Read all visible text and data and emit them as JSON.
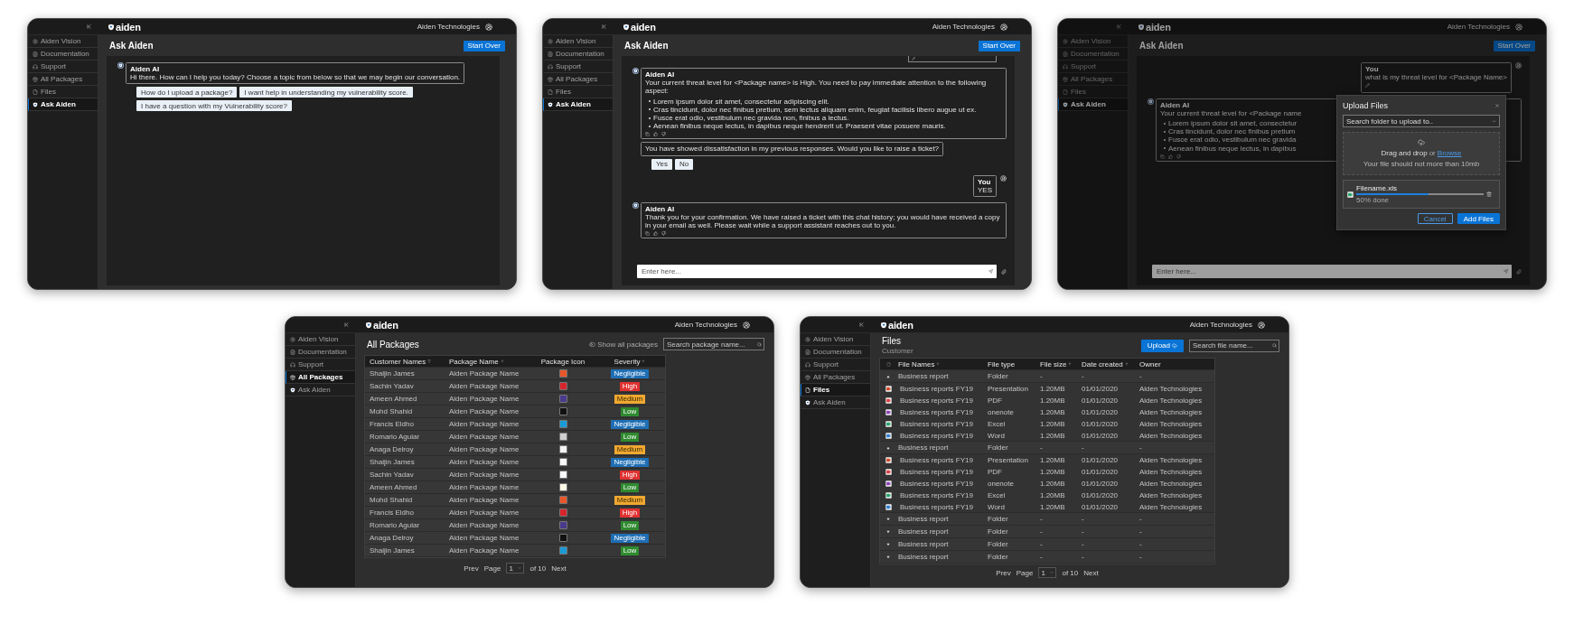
{
  "screens": [
    {
      "kind": "chat",
      "dimmed": false,
      "brand": "aiden",
      "user": "Aiden Technologies",
      "title": "Ask Aiden",
      "start_over": "Start Over",
      "sidebar": [
        {
          "kind": "vision",
          "label": "Aiden Vision",
          "selected": false
        },
        {
          "kind": "docs",
          "label": "Documentation",
          "selected": false
        },
        {
          "kind": "support",
          "label": "Support",
          "selected": false
        },
        {
          "kind": "packages",
          "label": "All Packages",
          "selected": false
        },
        {
          "kind": "files",
          "label": "Files",
          "selected": false
        },
        {
          "kind": "ask",
          "label": "Ask Aiden",
          "selected": true
        }
      ],
      "messages": [
        {
          "kind": "bot",
          "author": "Aiden AI",
          "text": "Hi there. How can I help you today? Choose a topic from below so that we may begin our conversation.",
          "feedback": false
        },
        {
          "kind": "options",
          "options": [
            "How do I upload a package?",
            "I want help in understanding my vulnerability score.",
            "I have a question with my Vulnerability score?"
          ]
        }
      ]
    },
    {
      "kind": "chat",
      "dimmed": false,
      "brand": "aiden",
      "user": "Aiden Technologies",
      "title": "Ask Aiden",
      "start_over": "Start Over",
      "sidebar": [
        {
          "kind": "vision",
          "label": "Aiden Vision",
          "selected": false
        },
        {
          "kind": "docs",
          "label": "Documentation",
          "selected": false
        },
        {
          "kind": "support",
          "label": "Support",
          "selected": false
        },
        {
          "kind": "packages",
          "label": "All Packages",
          "selected": false
        },
        {
          "kind": "files",
          "label": "Files",
          "selected": false
        },
        {
          "kind": "ask",
          "label": "Ask Aiden",
          "selected": true
        }
      ],
      "messages": [
        {
          "kind": "clipped"
        },
        {
          "kind": "bot",
          "author": "Aiden AI",
          "text": "Your current threat level for <Package name> is High. You need to pay immediate attention to the following aspect:",
          "bullets": [
            "Lorem ipsum dolor sit amet, consectetur adipiscing elit.",
            "Cras tincidunt, dolor nec finibus pretium, sem lectus aliquam enim, feugiat facilisis libero augue ut ex.",
            "Fusce erat odio, vestibulum nec gravida non, finibus a lectus.",
            "Aenean finibus neque lectus, in dapibus neque hendrerit ut. Praesent vitae posuere mauris."
          ],
          "feedback": true
        },
        {
          "kind": "notice",
          "text": "You have showed dissatisfaction in my previous responses. Would you like to raise a ticket?"
        },
        {
          "kind": "options",
          "options": [
            "Yes",
            "No"
          ]
        },
        {
          "kind": "user",
          "author": "You",
          "text": "YES",
          "editable": false
        },
        {
          "kind": "bot",
          "author": "Aiden AI",
          "text": "Thank you for your confirmation. We have raised a ticket with this chat history; you would have received a copy in your email as well. Please wait while a support assistant reaches out to you.",
          "feedback": true
        }
      ],
      "input": {
        "placeholder": "Enter here..."
      }
    },
    {
      "kind": "chat",
      "dimmed": true,
      "brand": "aiden",
      "user": "Aiden Technologies",
      "title": "Ask Aiden",
      "start_over": "Start Over",
      "sidebar": [
        {
          "kind": "vision",
          "label": "Aiden Vision",
          "selected": false
        },
        {
          "kind": "docs",
          "label": "Documentation",
          "selected": false
        },
        {
          "kind": "support",
          "label": "Support",
          "selected": false
        },
        {
          "kind": "packages",
          "label": "All Packages",
          "selected": false
        },
        {
          "kind": "files",
          "label": "Files",
          "selected": false
        },
        {
          "kind": "ask",
          "label": "Ask Aiden",
          "selected": true
        }
      ],
      "messages": [
        {
          "kind": "user",
          "author": "You",
          "text": "what is my threat level for <Package Name>",
          "editable": true
        },
        {
          "kind": "bot",
          "author": "Aiden AI",
          "text": "Your current threat level for <Package name",
          "bullets": [
            "Lorem ipsum dolor sit amet, consectetur",
            "Cras tincidunt, dolor nec finibus pretium",
            "Fusce erat odio, vestibulum nec gravida",
            "Aenean finibus neque lectus, in dapibus"
          ],
          "feedback": true
        }
      ],
      "input": {
        "placeholder": "Enter here..."
      },
      "modal": {
        "title": "Upload Files",
        "select": "Search folder to upload to..",
        "drop": "Drag and drop",
        "or": "or",
        "browse": "Browse",
        "hint": "Your file should not more than 10mb",
        "file": {
          "name": "Filename.xls",
          "level": 0.57,
          "status": "50% done"
        },
        "buttons": [
          "Cancel",
          "Add Files"
        ]
      }
    },
    {
      "kind": "packages",
      "brand": "aiden",
      "user": "Aiden Technologies",
      "title": "All Packages",
      "toggle": {
        "label": "Show all packages",
        "on": false
      },
      "search": {
        "placeholder": "Search package name..."
      },
      "sidebar": [
        {
          "kind": "vision",
          "label": "Aiden Vision",
          "selected": false
        },
        {
          "kind": "docs",
          "label": "Documentation",
          "selected": false
        },
        {
          "kind": "support",
          "label": "Support",
          "selected": false
        },
        {
          "kind": "packages",
          "label": "All Packages",
          "selected": true
        },
        {
          "kind": "ask",
          "label": "Ask Aiden",
          "selected": false
        }
      ],
      "columns": [
        {
          "label": "Customer Names",
          "kind": "filter"
        },
        {
          "label": "Package Name",
          "kind": "sort"
        },
        {
          "label": "Package Icon",
          "kind": "plain"
        },
        {
          "label": "Severity",
          "kind": "sort"
        }
      ],
      "rows": [
        {
          "customer": "Shaijin James",
          "package": "Aiden Package Name",
          "color": "#e8562a",
          "severity": {
            "label": "Negligible",
            "kind": "negligible"
          }
        },
        {
          "customer": "Sachin Yadav",
          "package": "Aiden Package Name",
          "color": "#d6262c",
          "severity": {
            "label": "High",
            "kind": "high"
          }
        },
        {
          "customer": "Ameen Ahmed",
          "package": "Aiden Package Name",
          "color": "#4a3a8c",
          "severity": {
            "label": "Medium",
            "kind": "medium"
          }
        },
        {
          "customer": "Mohd Shahid",
          "package": "Aiden Package Name",
          "color": "#111111",
          "severity": {
            "label": "Low",
            "kind": "low"
          }
        },
        {
          "customer": "Francis Eldho",
          "package": "Aiden Package Name",
          "color": "#1a9bd7",
          "severity": {
            "label": "Negligible",
            "kind": "negligible"
          }
        },
        {
          "customer": "Romario Aguiar",
          "package": "Aiden Package Name",
          "color": "#cfcfcf",
          "severity": {
            "label": "Low",
            "kind": "low"
          }
        },
        {
          "customer": "Anaga Delroy",
          "package": "Aiden Package Name",
          "color": "#f4f4f4",
          "severity": {
            "label": "Medium",
            "kind": "medium"
          }
        },
        {
          "customer": "Shaijin James",
          "package": "Aiden Package Name",
          "color": "#fafafa",
          "severity": {
            "label": "Negligible",
            "kind": "negligible"
          }
        },
        {
          "customer": "Sachin Yadav",
          "package": "Aiden Package Name",
          "color": "#f7f9fc",
          "severity": {
            "label": "High",
            "kind": "high"
          }
        },
        {
          "customer": "Ameen Ahmed",
          "package": "Aiden Package Name",
          "color": "#fff8e6",
          "severity": {
            "label": "Low",
            "kind": "low"
          }
        },
        {
          "customer": "Mohd Shahid",
          "package": "Aiden Package Name",
          "color": "#e8562a",
          "severity": {
            "label": "Medium",
            "kind": "medium"
          }
        },
        {
          "customer": "Francis Eldho",
          "package": "Aiden Package Name",
          "color": "#d6262c",
          "severity": {
            "label": "High",
            "kind": "high"
          }
        },
        {
          "customer": "Romario Aguiar",
          "package": "Aiden Package Name",
          "color": "#4a3a8c",
          "severity": {
            "label": "Low",
            "kind": "low"
          }
        },
        {
          "customer": "Anaga Delroy",
          "package": "Aiden Package Name",
          "color": "#111111",
          "severity": {
            "label": "Negligible",
            "kind": "negligible"
          }
        },
        {
          "customer": "Shaijin James",
          "package": "Aiden Package Name",
          "color": "#1a9bd7",
          "severity": {
            "label": "Low",
            "kind": "low"
          }
        }
      ],
      "pagination": {
        "prev": "Prev",
        "page": "Page",
        "current": "1",
        "of": "of 10",
        "next": "Next"
      }
    },
    {
      "kind": "files",
      "brand": "aiden",
      "user": "Aiden Technologies",
      "title": "Files",
      "subtitle": "Customer",
      "upload": "Upload",
      "search": {
        "placeholder": "Search file name..."
      },
      "sidebar": [
        {
          "kind": "vision",
          "label": "Aiden Vision",
          "selected": false
        },
        {
          "kind": "docs",
          "label": "Documentation",
          "selected": false
        },
        {
          "kind": "support",
          "label": "Support",
          "selected": false
        },
        {
          "kind": "packages",
          "label": "All Packages",
          "selected": false
        },
        {
          "kind": "files",
          "label": "Files",
          "selected": true
        },
        {
          "kind": "ask",
          "label": "Ask Aiden",
          "selected": false
        }
      ],
      "columns": [
        {
          "label": "File Names",
          "kind": "sort"
        },
        {
          "label": "File type",
          "kind": "plain"
        },
        {
          "label": "File size",
          "kind": "sort"
        },
        {
          "label": "Date created",
          "kind": "sort"
        },
        {
          "label": "Owner",
          "kind": "plain"
        }
      ],
      "folders": [
        {
          "name": "Business report",
          "type": "Folder",
          "size": "-",
          "date": "-",
          "owner": "-",
          "expanded": true,
          "children": [
            {
              "kind": "ppt",
              "name": "Business reports FY19",
              "type": "Presentation",
              "size": "1.20MB",
              "date": "01/01/2020",
              "owner": "Aiden Technologies"
            },
            {
              "kind": "pdf",
              "name": "Business reports FY19",
              "type": "PDF",
              "size": "1.20MB",
              "date": "01/01/2020",
              "owner": "Aiden Technologies"
            },
            {
              "kind": "onenote",
              "name": "Business reports FY19",
              "type": "onenote",
              "size": "1.20MB",
              "date": "01/01/2020",
              "owner": "Aiden Technologies"
            },
            {
              "kind": "excel",
              "name": "Business reports FY19",
              "type": "Excel",
              "size": "1.20MB",
              "date": "01/01/2020",
              "owner": "Aiden Technologies"
            },
            {
              "kind": "word",
              "name": "Business reports FY19",
              "type": "Word",
              "size": "1.20MB",
              "date": "01/01/2020",
              "owner": "Aiden Technologies"
            }
          ]
        },
        {
          "name": "Business report",
          "type": "Folder",
          "size": "-",
          "date": "-",
          "owner": "-",
          "expanded": true,
          "children": [
            {
              "kind": "ppt",
              "name": "Business reports FY19",
              "type": "Presentation",
              "size": "1.20MB",
              "date": "01/01/2020",
              "owner": "Aiden Technologies"
            },
            {
              "kind": "pdf",
              "name": "Business reports FY19",
              "type": "PDF",
              "size": "1.20MB",
              "date": "01/01/2020",
              "owner": "Aiden Technologies"
            },
            {
              "kind": "onenote",
              "name": "Business reports FY19",
              "type": "onenote",
              "size": "1.20MB",
              "date": "01/01/2020",
              "owner": "Aiden Technologies"
            },
            {
              "kind": "excel",
              "name": "Business reports FY19",
              "type": "Excel",
              "size": "1.20MB",
              "date": "01/01/2020",
              "owner": "Aiden Technologies"
            },
            {
              "kind": "word",
              "name": "Business reports FY19",
              "type": "Word",
              "size": "1.20MB",
              "date": "01/01/2020",
              "owner": "Aiden Technologies"
            }
          ]
        },
        {
          "name": "Business report",
          "type": "Folder",
          "size": "-",
          "date": "-",
          "owner": "-",
          "expanded": false
        },
        {
          "name": "Business report",
          "type": "Folder",
          "size": "-",
          "date": "-",
          "owner": "-",
          "expanded": false
        },
        {
          "name": "Business report",
          "type": "Folder",
          "size": "-",
          "date": "-",
          "owner": "-",
          "expanded": false
        },
        {
          "name": "Business report",
          "type": "Folder",
          "size": "-",
          "date": "-",
          "owner": "-",
          "expanded": false
        }
      ],
      "pagination": {
        "prev": "Prev",
        "page": "Page",
        "current": "1",
        "of": "of 10",
        "next": "Next"
      }
    }
  ]
}
